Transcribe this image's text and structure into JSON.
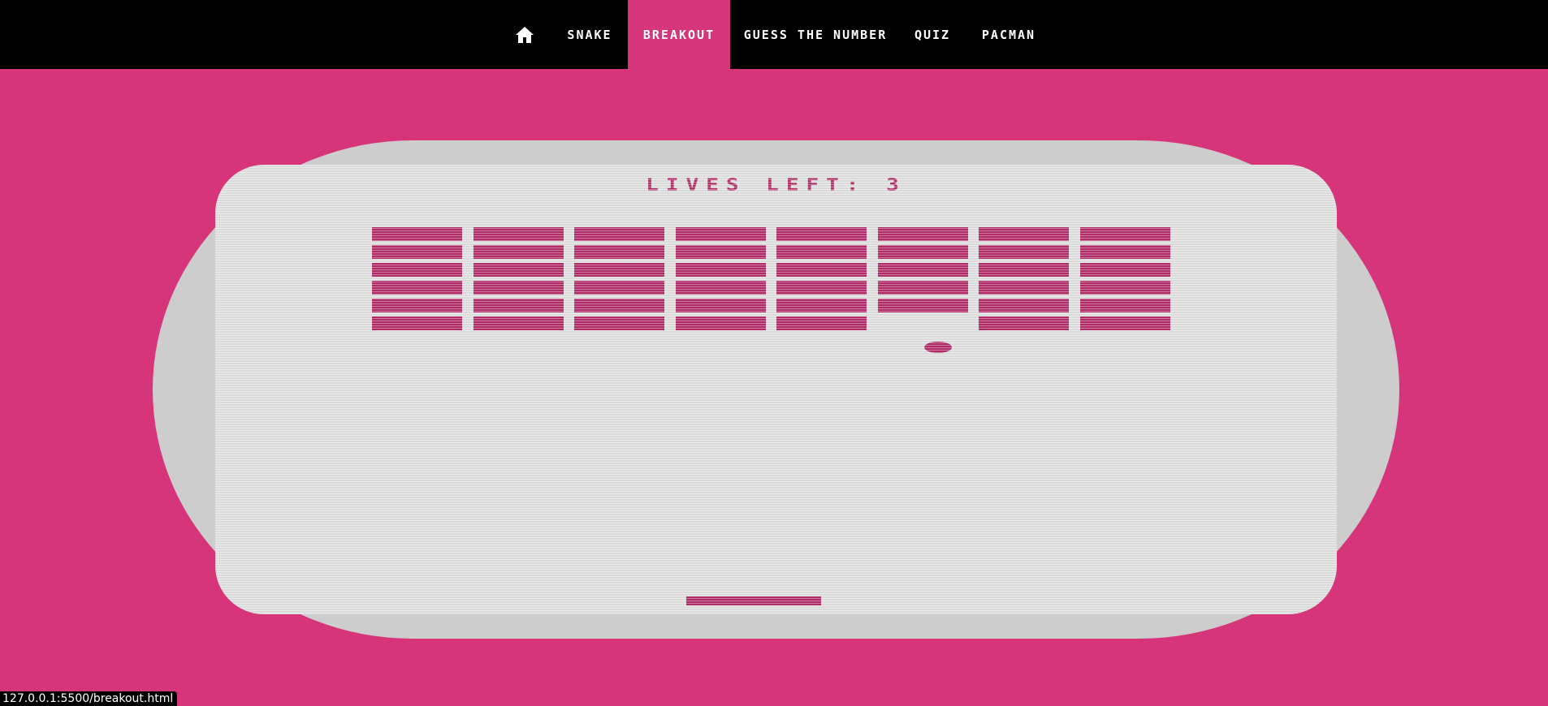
{
  "nav": {
    "home_icon": "home-icon",
    "items": [
      {
        "label": "SNAKE",
        "active": false
      },
      {
        "label": "BREAKOUT",
        "active": true
      },
      {
        "label": "GUESS THE NUMBER",
        "active": false
      },
      {
        "label": "QUIZ",
        "active": false
      },
      {
        "label": "PACMAN",
        "active": false
      }
    ]
  },
  "game": {
    "lives_label": "LIVES LEFT:",
    "lives_value": "3",
    "brick_columns": 8,
    "brick_rows": 6,
    "missing_bricks": [
      {
        "row": 5,
        "col": 5
      }
    ]
  },
  "status_bar": {
    "url": "127.0.0.1:5500/breakout.html"
  },
  "colors": {
    "background": "#d6357a",
    "nav_background": "#000000",
    "nav_active": "#d6357a",
    "console": "#cdcdcd",
    "screen": "#e1e1e1",
    "brick": "#b52e6a"
  }
}
